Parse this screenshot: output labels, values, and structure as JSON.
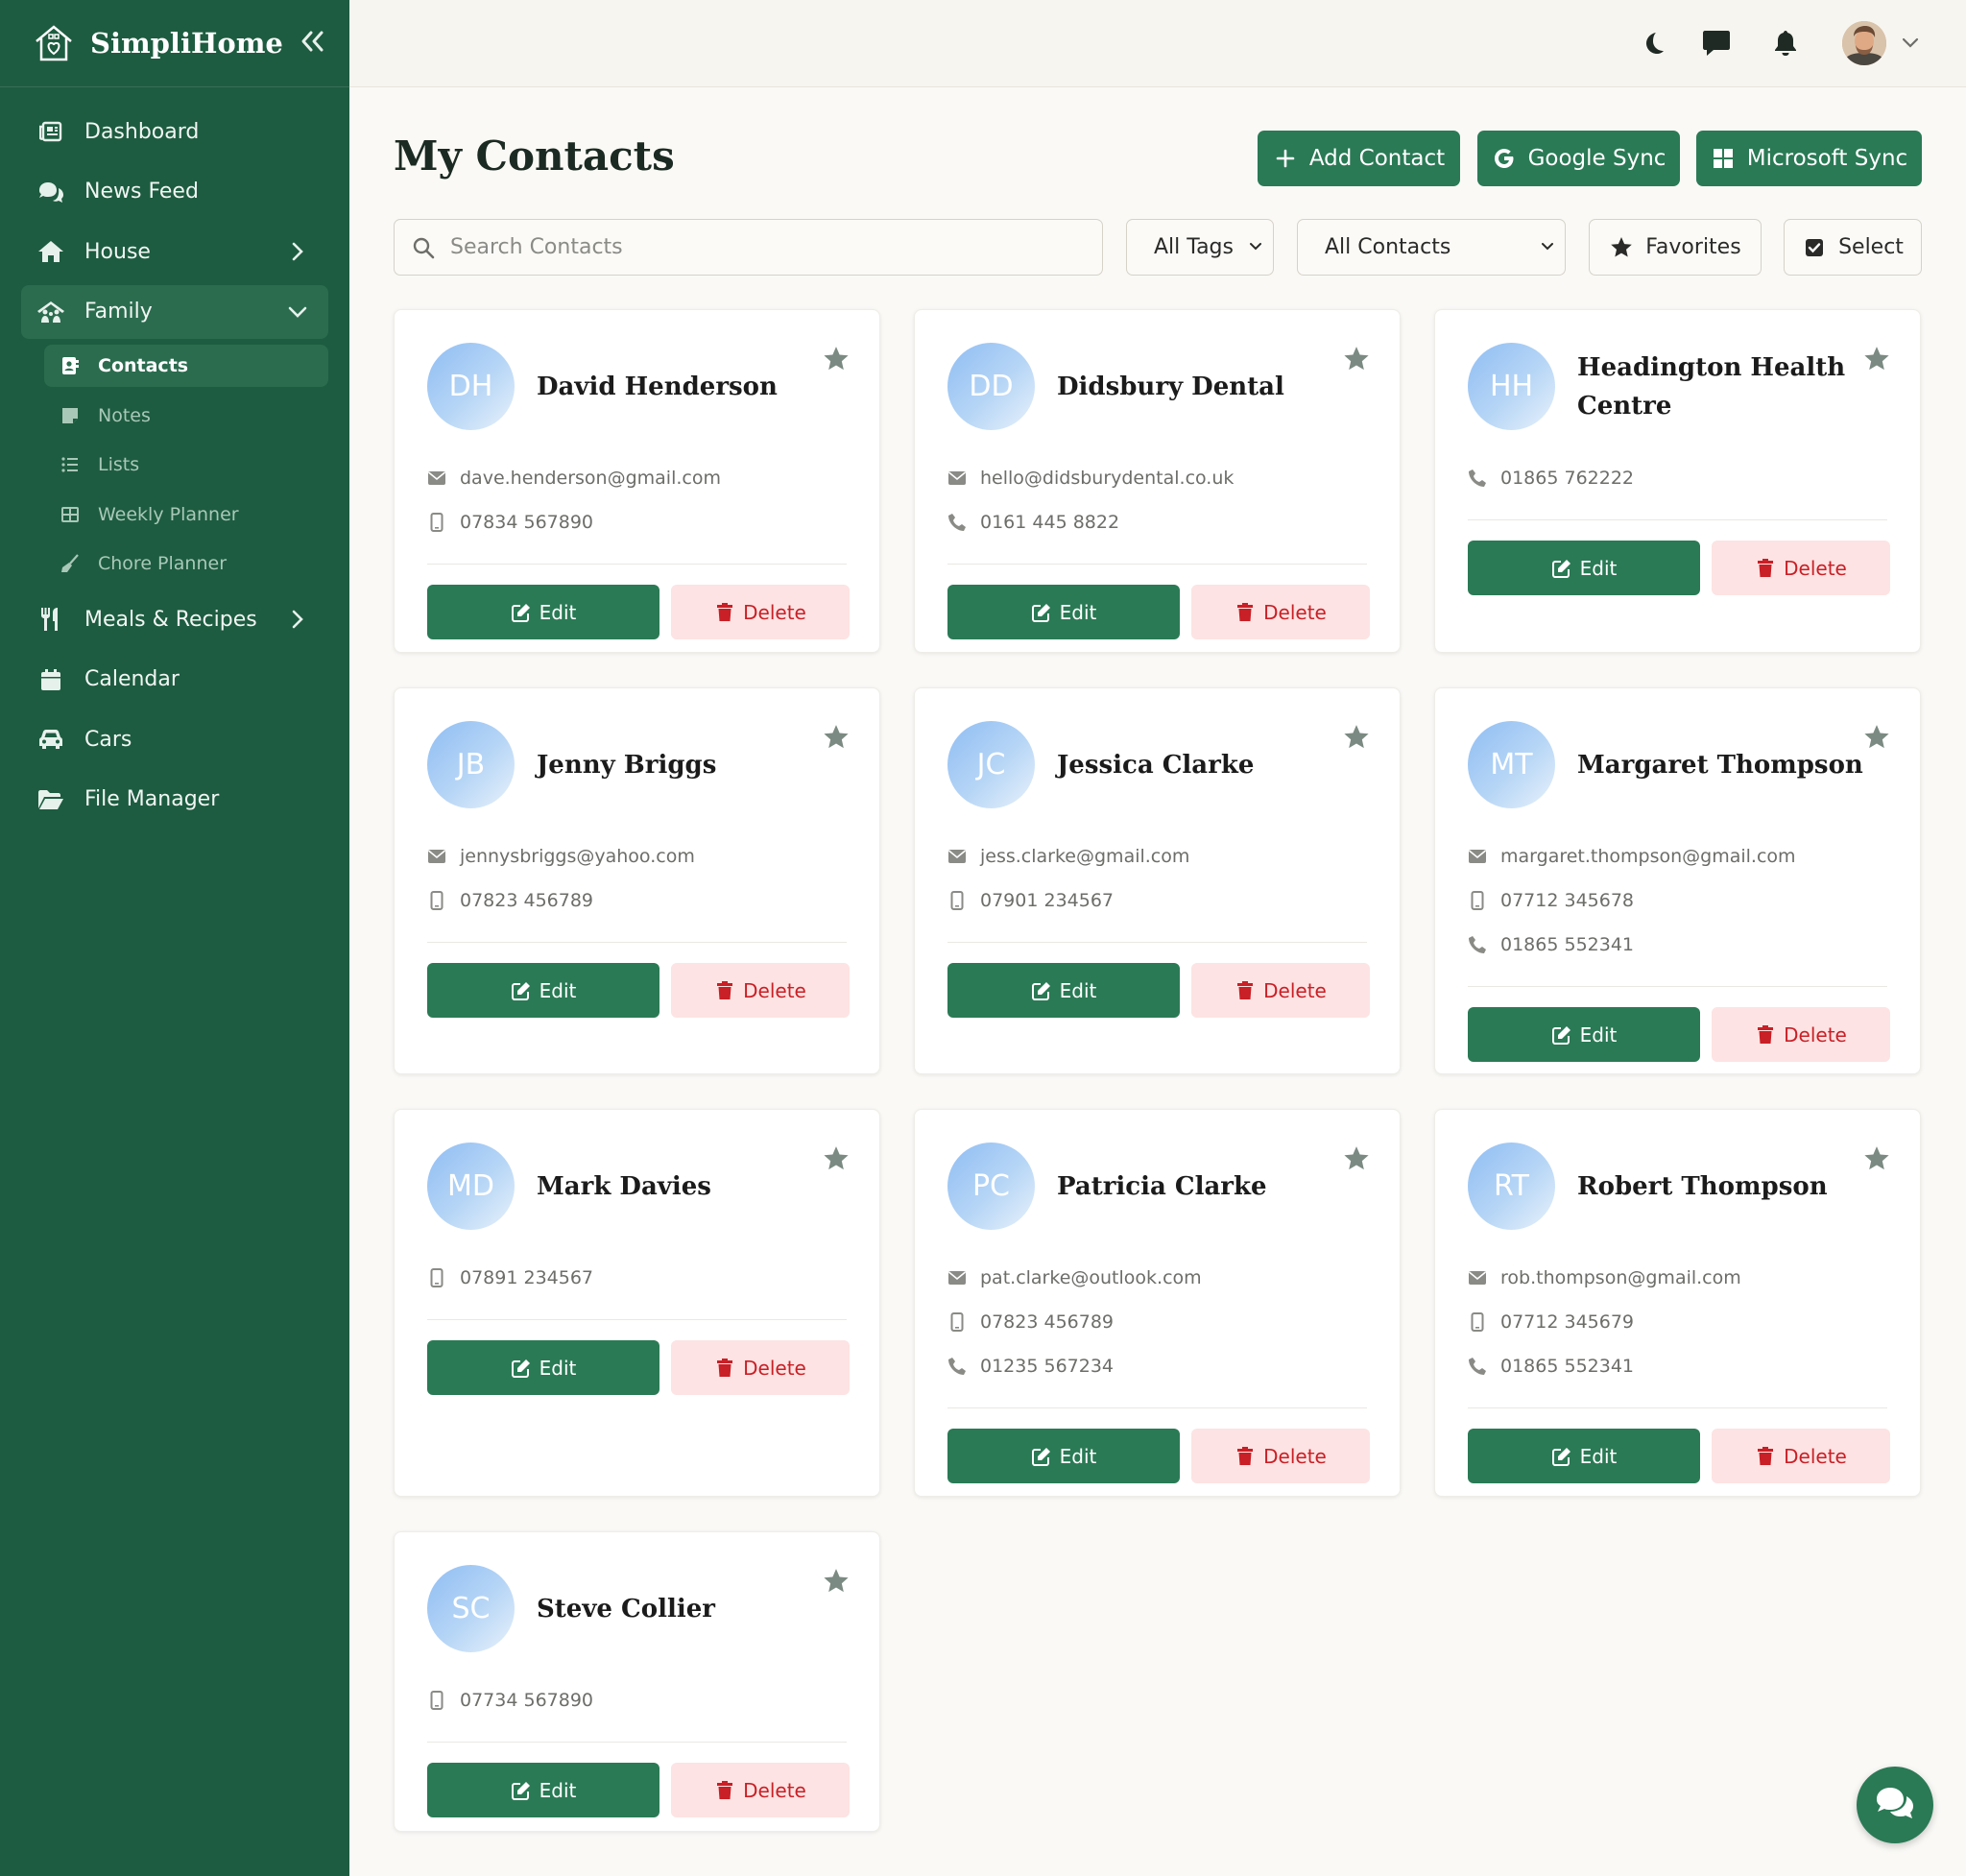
{
  "brand": {
    "name": "SimpliHome"
  },
  "sidebar": {
    "items": [
      {
        "label": "Dashboard",
        "icon": "newspaper-icon"
      },
      {
        "label": "News Feed",
        "icon": "comments-icon"
      },
      {
        "label": "House",
        "icon": "home-icon"
      },
      {
        "label": "Family",
        "icon": "family-icon"
      },
      {
        "label": "Meals & Recipes",
        "icon": "utensils-icon"
      },
      {
        "label": "Calendar",
        "icon": "calendar-icon"
      },
      {
        "label": "Cars",
        "icon": "car-icon"
      },
      {
        "label": "File Manager",
        "icon": "folder-icon"
      }
    ],
    "family_sub": [
      {
        "label": "Contacts",
        "icon": "contact-card-icon"
      },
      {
        "label": "Notes",
        "icon": "note-icon"
      },
      {
        "label": "Lists",
        "icon": "list-icon"
      },
      {
        "label": "Weekly Planner",
        "icon": "grid-icon"
      },
      {
        "label": "Chore Planner",
        "icon": "broom-icon"
      }
    ]
  },
  "header": {
    "title": "My Contacts",
    "add_label": "Add Contact",
    "google_label": "Google Sync",
    "microsoft_label": "Microsoft Sync"
  },
  "filters": {
    "search_placeholder": "Search Contacts",
    "tags_value": "All Tags",
    "contacts_value": "All Contacts",
    "favorites_label": "Favorites",
    "select_label": "Select"
  },
  "card_actions": {
    "edit": "Edit",
    "delete": "Delete"
  },
  "contacts": [
    {
      "initials": "DH",
      "name": "David Henderson",
      "email": "dave.henderson@gmail.com",
      "mobile": "07834 567890"
    },
    {
      "initials": "DD",
      "name": "Didsbury Dental",
      "email": "hello@didsburydental.co.uk",
      "phone": "0161 445 8822"
    },
    {
      "initials": "HH",
      "name": "Headington Health Centre",
      "phone": "01865 762222"
    },
    {
      "initials": "JB",
      "name": "Jenny Briggs",
      "email": "jennysbriggs@yahoo.com",
      "mobile": "07823 456789"
    },
    {
      "initials": "JC",
      "name": "Jessica Clarke",
      "email": "jess.clarke@gmail.com",
      "mobile": "07901 234567"
    },
    {
      "initials": "MT",
      "name": "Margaret Thompson",
      "email": "margaret.thompson@gmail.com",
      "mobile": "07712 345678",
      "phone": "01865 552341"
    },
    {
      "initials": "MD",
      "name": "Mark Davies",
      "mobile": "07891 234567"
    },
    {
      "initials": "PC",
      "name": "Patricia Clarke",
      "email": "pat.clarke@outlook.com",
      "mobile": "07823 456789",
      "phone": "01235 567234"
    },
    {
      "initials": "RT",
      "name": "Robert Thompson",
      "email": "rob.thompson@gmail.com",
      "mobile": "07712 345679",
      "phone": "01865 552341"
    },
    {
      "initials": "SC",
      "name": "Steve Collier",
      "mobile": "07734 567890"
    }
  ],
  "colors": {
    "sidebar": "#1d5c40",
    "primary_button": "#2a7a55",
    "delete_bg": "#fde3e3",
    "delete_text": "#c91f26",
    "star": "#7b8a82"
  }
}
